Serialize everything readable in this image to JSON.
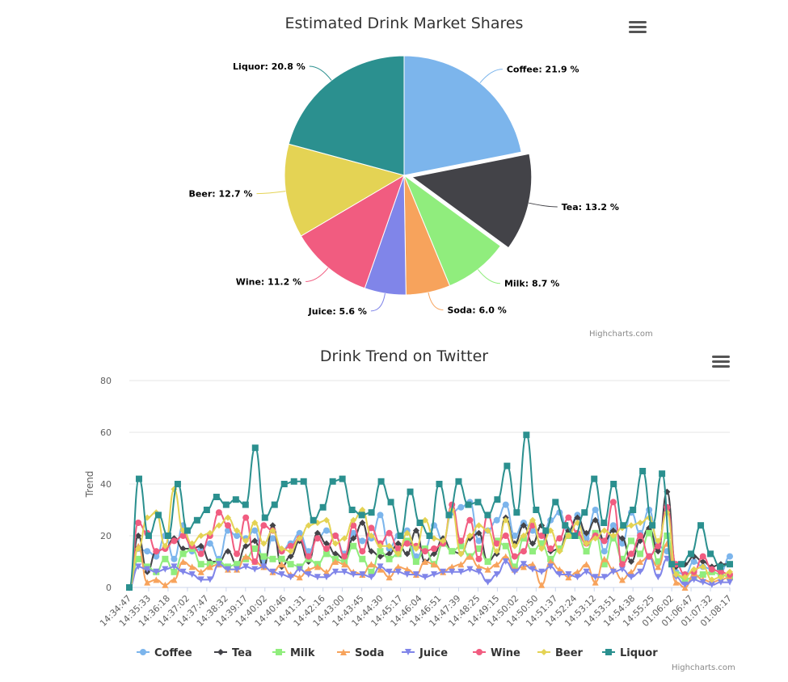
{
  "chart_data": [
    {
      "type": "pie",
      "title": "Estimated Drink Market Shares",
      "credits": "Highcharts.com",
      "slices": [
        {
          "name": "Coffee",
          "value": 21.9,
          "color": "#7cb5ec",
          "sliced": false,
          "label": "Coffee: 21.9 %"
        },
        {
          "name": "Tea",
          "value": 13.2,
          "color": "#434348",
          "sliced": true,
          "label": "Tea: 13.2 %"
        },
        {
          "name": "Milk",
          "value": 8.7,
          "color": "#90ed7d",
          "sliced": false,
          "label": "Milk: 8.7 %"
        },
        {
          "name": "Soda",
          "value": 6.0,
          "color": "#f7a35c",
          "sliced": false,
          "label": "Soda: 6.0 %"
        },
        {
          "name": "Juice",
          "value": 5.6,
          "color": "#8085e9",
          "sliced": false,
          "label": "Juice: 5.6 %"
        },
        {
          "name": "Wine",
          "value": 11.2,
          "color": "#f15c80",
          "sliced": false,
          "label": "Wine: 11.2 %"
        },
        {
          "name": "Beer",
          "value": 12.7,
          "color": "#e4d354",
          "sliced": false,
          "label": "Beer: 12.7 %"
        },
        {
          "name": "Liquor",
          "value": 20.8,
          "color": "#2b908f",
          "sliced": false,
          "label": "Liquor: 20.8 %"
        }
      ]
    },
    {
      "type": "line",
      "title": "Drink Trend on Twitter",
      "ylabel": "Trend",
      "ylim": [
        0,
        80
      ],
      "yticks": [
        0,
        20,
        40,
        60,
        80
      ],
      "grid": true,
      "legend_position": "bottom",
      "credits": "Highcharts.com",
      "x_tick_labels": [
        "14:34:47",
        "14:35:33",
        "14:36:18",
        "14:37:02",
        "14:37:47",
        "14:38:32",
        "14:39:17",
        "14:40:02",
        "14:40:46",
        "14:41:31",
        "14:42:16",
        "14:43:00",
        "14:43:45",
        "14:44:30",
        "14:45:17",
        "14:46:04",
        "14:46:51",
        "14:47:39",
        "14:48:25",
        "14:49:15",
        "14:50:02",
        "14:50:50",
        "14:51:37",
        "14:52:24",
        "14:53:12",
        "14:53:51",
        "14:54:38",
        "14:55:25",
        "01:06:02",
        "01:06:47",
        "01:07:32",
        "01:08:17"
      ],
      "series": [
        {
          "name": "Coffee",
          "color": "#7cb5ec",
          "marker": "circle",
          "values": [
            0,
            15,
            14,
            12,
            20,
            11,
            24,
            14,
            15,
            17,
            11,
            22,
            20,
            19,
            22,
            10,
            19,
            14,
            17,
            21,
            14,
            19,
            22,
            20,
            13,
            21,
            18,
            19,
            28,
            15,
            20,
            22,
            12,
            15,
            24,
            18,
            29,
            31,
            33,
            18,
            22,
            26,
            32,
            20,
            25,
            22,
            17,
            26,
            29,
            21,
            28,
            19,
            30,
            14,
            24,
            17,
            29,
            21,
            30,
            16,
            14,
            6,
            5,
            10,
            8,
            7,
            6,
            12
          ]
        },
        {
          "name": "Tea",
          "color": "#434348",
          "marker": "diamond",
          "values": [
            0,
            20,
            6,
            14,
            15,
            19,
            15,
            15,
            16,
            10,
            10,
            14,
            9,
            16,
            18,
            8,
            24,
            8,
            12,
            18,
            10,
            21,
            17,
            13,
            11,
            19,
            25,
            14,
            12,
            13,
            17,
            13,
            22,
            10,
            13,
            19,
            14,
            13,
            19,
            21,
            10,
            13,
            27,
            17,
            24,
            17,
            24,
            14,
            15,
            22,
            27,
            21,
            26,
            18,
            22,
            19,
            10,
            18,
            23,
            14,
            37,
            8,
            9,
            12,
            10,
            8,
            9,
            9
          ]
        },
        {
          "name": "Milk",
          "color": "#90ed7d",
          "marker": "square",
          "values": [
            0,
            11,
            8,
            6,
            11,
            6,
            13,
            15,
            9,
            9,
            10,
            8,
            9,
            11,
            15,
            12,
            11,
            11,
            9,
            8,
            11,
            9,
            13,
            11,
            10,
            16,
            11,
            6,
            14,
            11,
            13,
            18,
            10,
            15,
            9,
            17,
            14,
            16,
            12,
            15,
            10,
            18,
            16,
            8,
            19,
            14,
            17,
            11,
            15,
            20,
            20,
            14,
            21,
            9,
            19,
            11,
            18,
            13,
            21,
            10,
            20,
            5,
            3,
            4,
            5,
            6,
            5,
            4
          ]
        },
        {
          "name": "Soda",
          "color": "#f7a35c",
          "marker": "triangle",
          "values": [
            0,
            16,
            2,
            3,
            1,
            3,
            10,
            8,
            6,
            8,
            9,
            7,
            7,
            12,
            10,
            8,
            6,
            9,
            5,
            4,
            7,
            8,
            6,
            10,
            9,
            6,
            5,
            9,
            7,
            4,
            8,
            7,
            5,
            10,
            9,
            6,
            8,
            9,
            12,
            8,
            7,
            9,
            12,
            7,
            8,
            9,
            1,
            10,
            7,
            4,
            6,
            9,
            2,
            11,
            7,
            3,
            6,
            10,
            12,
            8,
            17,
            2,
            0,
            5,
            3,
            2,
            3,
            4
          ]
        },
        {
          "name": "Juice",
          "color": "#8085e9",
          "marker": "triangle-down",
          "values": [
            0,
            8,
            7,
            6,
            7,
            8,
            6,
            5,
            3,
            3,
            9,
            7,
            7,
            8,
            7,
            8,
            6,
            5,
            4,
            7,
            5,
            4,
            4,
            6,
            6,
            5,
            5,
            4,
            8,
            6,
            6,
            5,
            5,
            4,
            5,
            6,
            6,
            6,
            7,
            6,
            2,
            5,
            10,
            6,
            9,
            7,
            6,
            8,
            5,
            5,
            4,
            6,
            4,
            4,
            6,
            7,
            4,
            6,
            12,
            4,
            11,
            4,
            1,
            3,
            2,
            1,
            2,
            2
          ]
        },
        {
          "name": "Wine",
          "color": "#f15c80",
          "marker": "circle",
          "values": [
            0,
            25,
            21,
            14,
            15,
            18,
            20,
            16,
            13,
            20,
            29,
            24,
            13,
            27,
            10,
            24,
            22,
            14,
            16,
            19,
            12,
            19,
            15,
            20,
            12,
            24,
            14,
            23,
            17,
            21,
            15,
            17,
            16,
            14,
            15,
            17,
            32,
            18,
            26,
            11,
            28,
            17,
            20,
            12,
            14,
            24,
            20,
            15,
            19,
            27,
            21,
            17,
            20,
            18,
            33,
            9,
            13,
            20,
            12,
            16,
            31,
            9,
            5,
            6,
            12,
            7,
            6,
            5
          ]
        },
        {
          "name": "Beer",
          "color": "#e4d354",
          "marker": "diamond",
          "values": [
            0,
            15,
            27,
            29,
            16,
            38,
            22,
            17,
            20,
            21,
            24,
            27,
            22,
            18,
            25,
            17,
            22,
            15,
            14,
            19,
            24,
            25,
            26,
            17,
            19,
            26,
            30,
            20,
            16,
            16,
            13,
            21,
            15,
            26,
            19,
            18,
            30,
            13,
            20,
            24,
            22,
            14,
            26,
            16,
            20,
            26,
            15,
            22,
            14,
            20,
            25,
            17,
            19,
            22,
            20,
            23,
            24,
            25,
            27,
            18,
            29,
            5,
            4,
            7,
            8,
            3,
            4,
            6
          ]
        },
        {
          "name": "Liquor",
          "color": "#2b908f",
          "marker": "square",
          "values": [
            0,
            42,
            20,
            28,
            20,
            40,
            22,
            26,
            30,
            35,
            32,
            34,
            32,
            54,
            27,
            32,
            40,
            41,
            41,
            26,
            31,
            41,
            42,
            30,
            28,
            29,
            41,
            33,
            20,
            37,
            25,
            20,
            40,
            28,
            41,
            32,
            33,
            28,
            34,
            47,
            29,
            59,
            30,
            22,
            33,
            24,
            20,
            29,
            42,
            25,
            40,
            24,
            30,
            45,
            24,
            44,
            9,
            9,
            13,
            24,
            13,
            8,
            9
          ]
        }
      ]
    }
  ]
}
